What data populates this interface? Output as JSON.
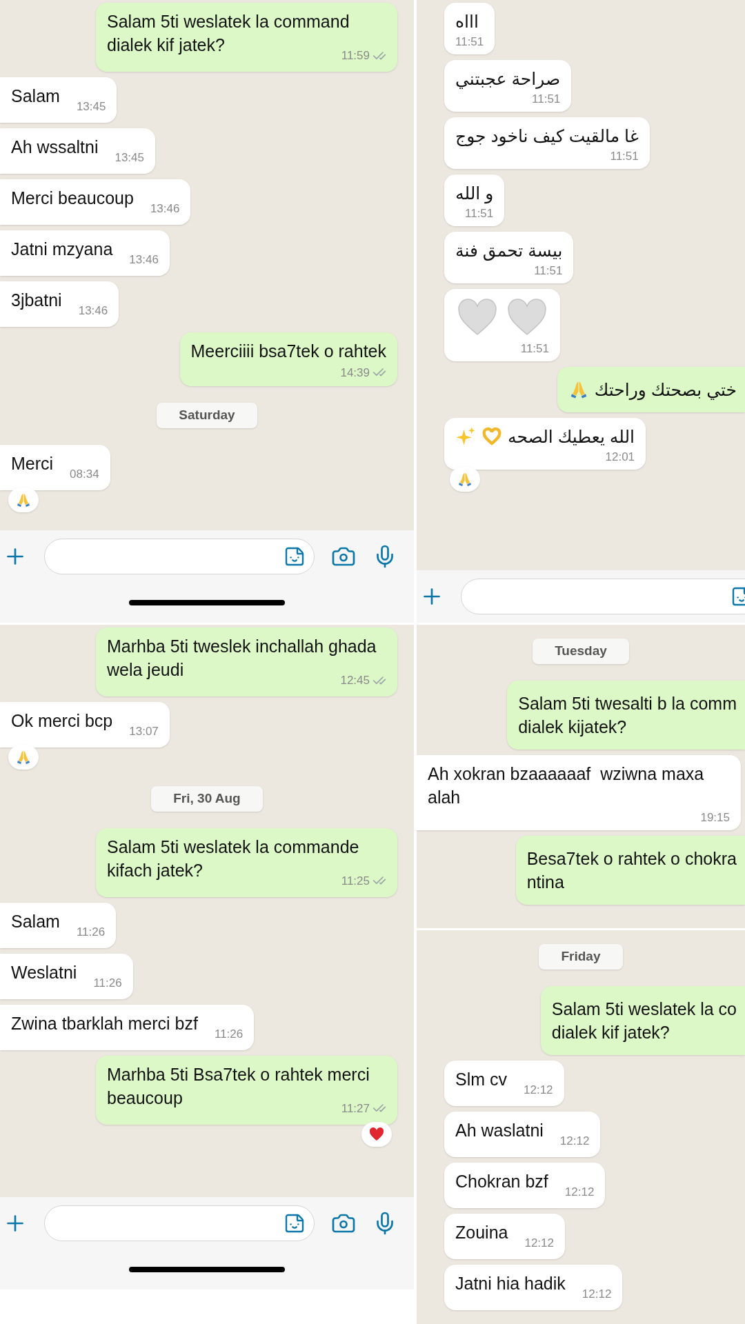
{
  "columns": [
    [
      {
        "inset": false,
        "home_indicator": true,
        "composer": {
          "sticker": true,
          "camera": true,
          "mic": true
        },
        "messages": [
          {
            "kind": "out",
            "text": "Salam 5ti weslatek la command dialek kif jatek?",
            "time": "11:59",
            "ticks": true
          },
          {
            "kind": "in",
            "text": "Salam",
            "time": "13:45"
          },
          {
            "kind": "in",
            "text": "Ah wssaltni",
            "time": "13:45"
          },
          {
            "kind": "in",
            "text": "Merci beaucoup",
            "time": "13:46"
          },
          {
            "kind": "in",
            "text": "Jatni mzyana",
            "time": "13:46"
          },
          {
            "kind": "in",
            "text": "3jbatni",
            "time": "13:46"
          },
          {
            "kind": "out",
            "text": "Meerciiii bsa7tek o rahtek",
            "time": "14:39",
            "ticks": true,
            "time_below": true
          },
          {
            "kind": "date",
            "text": "Saturday"
          },
          {
            "kind": "in",
            "text": "Merci",
            "time": "08:34",
            "reaction": {
              "kind": "pray"
            }
          }
        ]
      },
      {
        "inset": false,
        "home_indicator": true,
        "composer": {
          "sticker": true,
          "camera": true,
          "mic": true
        },
        "messages": [
          {
            "kind": "out",
            "text": "Marhba 5ti tweslek inchallah ghada wela jeudi",
            "time": "12:45",
            "ticks": true
          },
          {
            "kind": "in",
            "text": "Ok merci bcp",
            "time": "13:07",
            "reaction": {
              "kind": "pray"
            }
          },
          {
            "kind": "date",
            "text": "Fri, 30 Aug"
          },
          {
            "kind": "out",
            "text": "Salam 5ti weslatek la commande kifach jatek?",
            "time": "11:25",
            "ticks": true
          },
          {
            "kind": "in",
            "text": "Salam",
            "time": "11:26"
          },
          {
            "kind": "in",
            "text": "Weslatni",
            "time": "11:26"
          },
          {
            "kind": "in",
            "text": "Zwina tbarklah merci bzf",
            "time": "11:26"
          },
          {
            "kind": "out",
            "text": "Marhba 5ti Bsa7tek o rahtek merci beaucoup",
            "time": "11:27",
            "ticks": true,
            "reaction": {
              "kind": "heart"
            }
          }
        ]
      }
    ],
    [
      {
        "inset": true,
        "home_indicator": false,
        "composer": {
          "sticker": true,
          "camera": false,
          "mic": false
        },
        "messages": [
          {
            "kind": "in",
            "text": "اااه",
            "time": "11:51",
            "time_below": true
          },
          {
            "kind": "in",
            "text": "صراحة عجبتني",
            "time": "11:51",
            "time_below": true
          },
          {
            "kind": "in",
            "text": "غا مالقيت كيف ناخود جوج",
            "time": "11:51",
            "time_below": true
          },
          {
            "kind": "in",
            "text": "و الله",
            "time": "11:51",
            "time_below": true
          },
          {
            "kind": "in",
            "text": "بيسة تحمق فنة",
            "time": "11:51",
            "time_below": true
          },
          {
            "kind": "in",
            "emojis": [
              {
                "kind": "white_heart"
              },
              {
                "kind": "white_heart"
              }
            ],
            "time": "11:51",
            "time_below": true
          },
          {
            "kind": "out",
            "text": "ختي بصحتك وراحتك",
            "emojis": [
              {
                "kind": "pray"
              }
            ],
            "cut": true
          },
          {
            "kind": "in",
            "text": "الله يعطيك الصحه",
            "emojis": [
              {
                "kind": "heart_hands"
              },
              {
                "kind": "sparkles"
              }
            ],
            "time": "12:01",
            "time_below": true,
            "reaction": {
              "kind": "pray"
            }
          }
        ]
      },
      {
        "inset": false,
        "home_indicator": false,
        "messages": [
          {
            "kind": "date",
            "text": "Tuesday"
          },
          {
            "kind": "out",
            "text": "Salam 5ti twesalti b la comm\ndialek kijatek?",
            "cut": true
          },
          {
            "kind": "in",
            "text": "Ah xokran bzaaaaaaf  wziwna maxa alah",
            "time": "19:15",
            "time_below": true
          },
          {
            "kind": "out",
            "text": "Besa7tek o rahtek o chokra\nntina",
            "cut": true
          }
        ]
      },
      {
        "inset": true,
        "home_indicator": false,
        "messages": [
          {
            "kind": "date",
            "text": "Friday"
          },
          {
            "kind": "out",
            "text": "Salam 5ti weslatek la co\ndialek kif jatek?",
            "cut": true
          },
          {
            "kind": "in",
            "text": "Slm cv",
            "time": "12:12"
          },
          {
            "kind": "in",
            "text": "Ah waslatni",
            "time": "12:12"
          },
          {
            "kind": "in",
            "text": "Chokran bzf",
            "time": "12:12"
          },
          {
            "kind": "in",
            "text": "Zouina",
            "time": "12:12"
          },
          {
            "kind": "in",
            "text": "Jatni hia hadik",
            "time": "12:12"
          }
        ]
      }
    ]
  ]
}
